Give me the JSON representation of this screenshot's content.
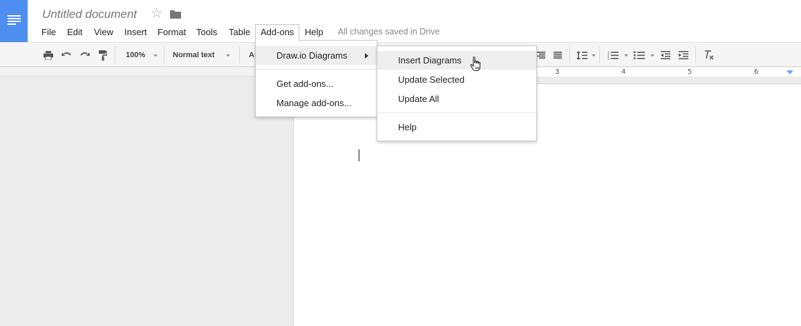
{
  "document": {
    "title": "Untitled document",
    "save_status": "All changes saved in Drive"
  },
  "menubar": {
    "items": [
      "File",
      "Edit",
      "View",
      "Insert",
      "Format",
      "Tools",
      "Table",
      "Add-ons",
      "Help"
    ],
    "open_menu": "Add-ons"
  },
  "toolbar": {
    "zoom": "100%",
    "style": "Normal text",
    "font_partial": "Ar"
  },
  "ruler": {
    "numbers": [
      "3",
      "4",
      "5",
      "6"
    ]
  },
  "addons_menu": {
    "items": [
      "Draw.io Diagrams",
      "Get add-ons...",
      "Manage add-ons..."
    ],
    "highlighted": "Draw.io Diagrams"
  },
  "drawio_submenu": {
    "items": [
      "Insert Diagrams",
      "Update Selected",
      "Update All",
      "Help"
    ],
    "highlighted": "Insert Diagrams"
  },
  "colors": {
    "brand_blue": "#4d8ef0",
    "indent_marker": "#6aa5f5"
  },
  "icons": {
    "logo": "docs-lines-icon",
    "star": "star-outline-icon",
    "folder": "folder-icon",
    "print": "print-icon",
    "undo": "undo-icon",
    "redo": "redo-icon",
    "paint_format": "paint-roller-icon",
    "align": "align-icons",
    "line_spacing": "line-spacing-icon",
    "numbered_list": "numbered-list-icon",
    "bulleted_list": "bulleted-list-icon",
    "indent": "indent-icons",
    "clear_formatting": "clear-formatting-icon",
    "cursor": "hand-pointer-icon"
  }
}
